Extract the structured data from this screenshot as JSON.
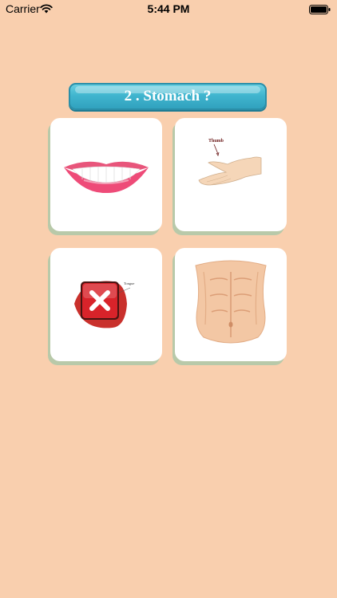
{
  "status_bar": {
    "carrier": "Carrier",
    "time": "5:44 PM",
    "icons": [
      "wifi-icon",
      "battery-icon"
    ]
  },
  "question": {
    "text": "2 . Stomach ?"
  },
  "options": [
    {
      "name": "lips",
      "label": "",
      "state": "neutral"
    },
    {
      "name": "thumb",
      "label": "Thumb",
      "state": "neutral"
    },
    {
      "name": "tongue",
      "label": "Tongue",
      "state": "wrong",
      "mark": "x-icon"
    },
    {
      "name": "stomach",
      "label": "",
      "state": "neutral"
    }
  ],
  "colors": {
    "background": "#f9cfae",
    "banner": "#41b6cf",
    "card_shadow": "#b8c9a9",
    "wrong_mark": "#d8232a"
  }
}
